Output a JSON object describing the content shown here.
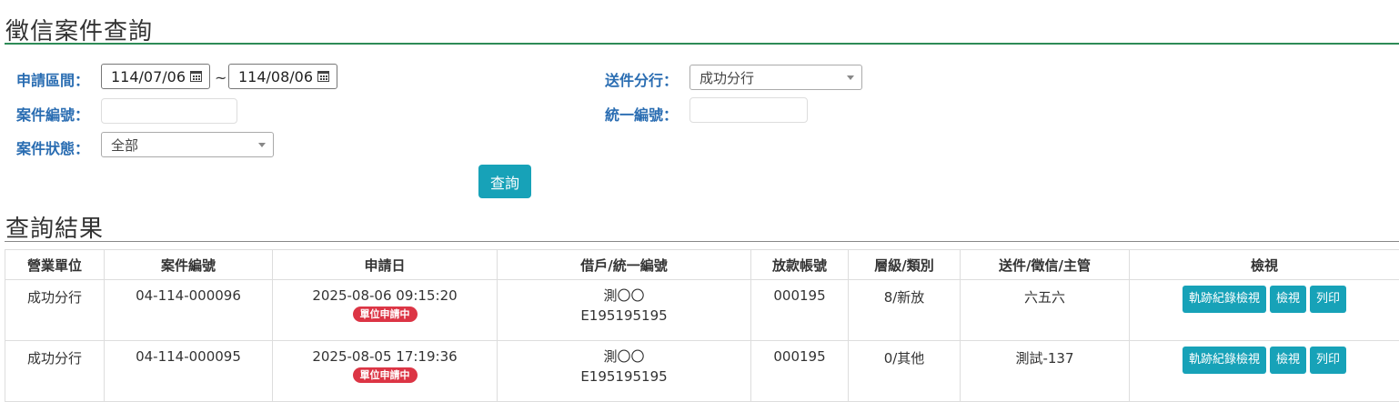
{
  "page": {
    "title": "徵信案件查詢"
  },
  "form": {
    "apply_period_label": "申請區間：",
    "date_from": "114/07/06",
    "date_separator": "~",
    "date_to": "114/08/06",
    "send_branch_label": "送件分行：",
    "send_branch_value": "成功分行",
    "case_no_label": "案件編號：",
    "case_no_value": "",
    "tax_id_label": "統一編號：",
    "tax_id_value": "",
    "status_label": "案件狀態：",
    "status_value": "全部",
    "query_button": "查詢"
  },
  "results": {
    "title": "查詢結果",
    "headers": [
      "營業單位",
      "案件編號",
      "申請日",
      "借戶/統一編號",
      "放款帳號",
      "層級/類別",
      "送件/徵信/主管",
      "檢視"
    ],
    "rows": [
      {
        "unit": "成功分行",
        "case_no": "04-114-000096",
        "apply_date": "2025-08-06 09:15:20",
        "badge": "單位申請中",
        "borrower": "測〇〇",
        "tax_id": "E195195195",
        "loan_account": "000195",
        "level_category": "8/新放",
        "staff": "六五六",
        "actions": [
          "軌跡紀錄檢視",
          "檢視",
          "列印"
        ]
      },
      {
        "unit": "成功分行",
        "case_no": "04-114-000095",
        "apply_date": "2025-08-05 17:19:36",
        "badge": "單位申請中",
        "borrower": "測〇〇",
        "tax_id": "E195195195",
        "loan_account": "000195",
        "level_category": "0/其他",
        "staff": "測試-137",
        "actions": [
          "軌跡紀錄檢視",
          "檢視",
          "列印"
        ]
      }
    ]
  },
  "colors": {
    "accent": "#17a2b8",
    "label": "#2a6db2",
    "badge": "#dc3545",
    "rule": "#2e8b57"
  }
}
